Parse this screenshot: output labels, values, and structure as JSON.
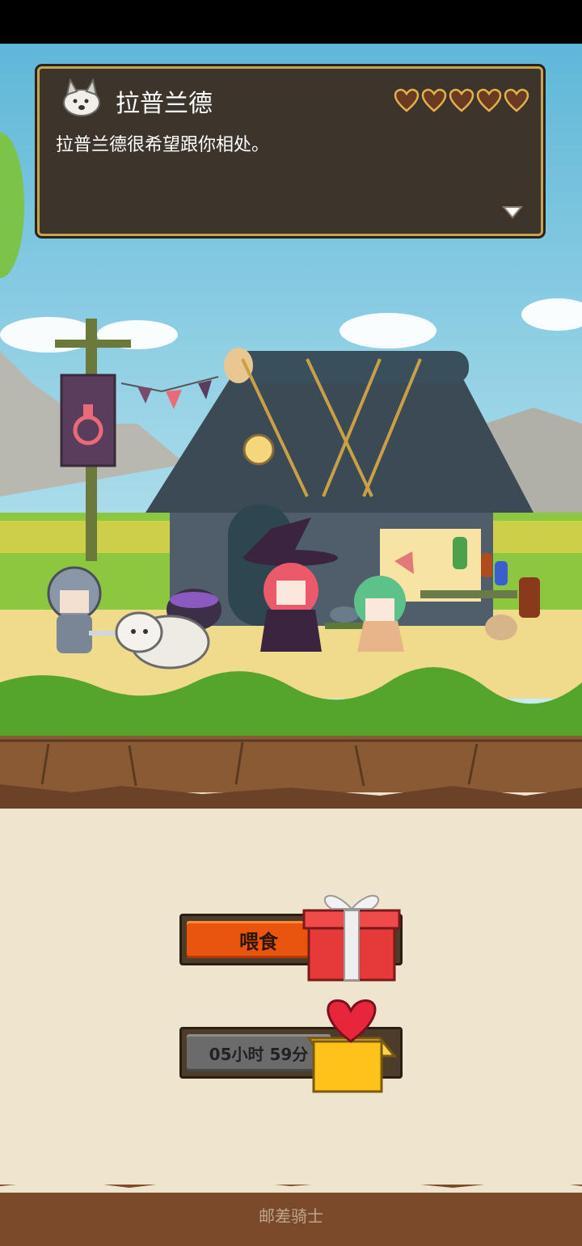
{
  "dialog": {
    "speaker": "拉普兰德",
    "message": "拉普兰德很希望跟你相处。",
    "hearts": 5
  },
  "actions": {
    "feed_label": "喂食",
    "timer_label": "05小时 59分"
  },
  "footer": {
    "label": "邮差骑士"
  },
  "icons": [
    "wolf-portrait-icon",
    "heart-icon",
    "down-arrow-icon",
    "gift-box-icon",
    "heart-box-icon",
    "potion-banner-icon"
  ],
  "colors": {
    "feed_button": "#e9540e",
    "timer_button": "#6b6b6b",
    "dialog_bg": "#3d342c",
    "dialog_border": "#c8a54a"
  }
}
